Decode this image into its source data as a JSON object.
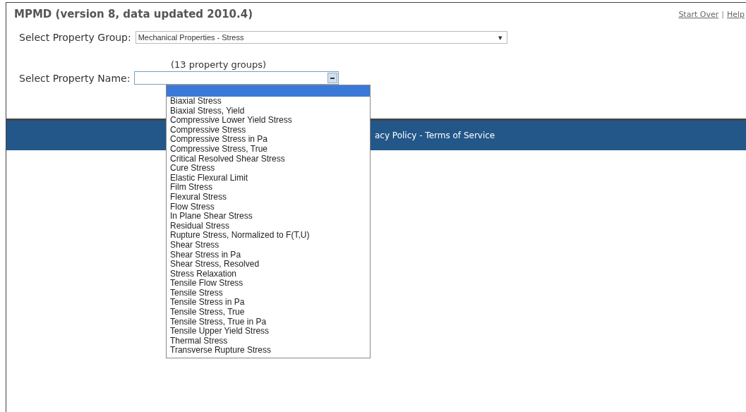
{
  "title": "MPMD (version 8, data updated 2010.4)",
  "top_links": [
    "Start Over",
    "Help"
  ],
  "top_links_separator": "|",
  "property_group": {
    "label": "Select Property Group:",
    "value": "Mechanical Properties - Stress",
    "caret": "▾"
  },
  "group_count": "(13 property groups)",
  "property_name": {
    "label": "Select Property Name:",
    "expanded": true,
    "options": [
      "Biaxial Stress",
      "Biaxial Stress, Yield",
      "Compressive Lower Yield Stress",
      "Compressive Stress",
      "Compressive Stress in Pa",
      "Compressive Stress, True",
      "Critical Resolved Shear Stress",
      "Cure Stress",
      "Elastic Flexural Limit",
      "Film Stress",
      "Flexural Stress",
      "Flow Stress",
      "In Plane Shear Stress",
      "Residual Stress",
      "Rupture Stress, Normalized to F(T,U)",
      "Shear Stress",
      "Shear Stress in Pa",
      "Shear Stress, Resolved",
      "Stress Relaxation",
      "Tensile Flow Stress",
      "Tensile Stress",
      "Tensile Stress in Pa",
      "Tensile Stress, True",
      "Tensile Stress, True in Pa",
      "Tensile Upper Yield Stress",
      "Thermal Stress",
      "Transverse Rupture Stress"
    ]
  },
  "footer": {
    "text": "acy Policy - Terms of Service"
  }
}
